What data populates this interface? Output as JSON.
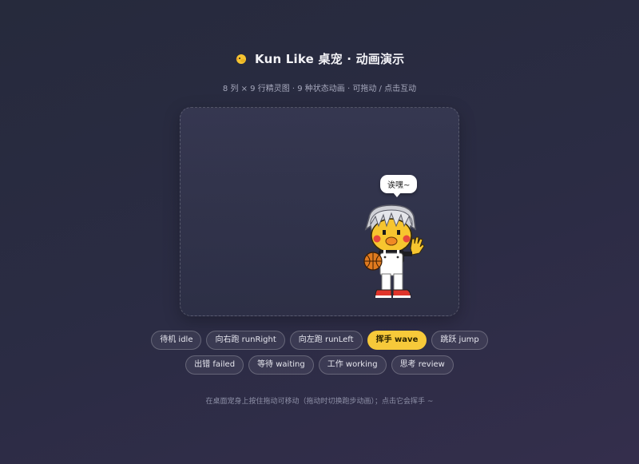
{
  "header": {
    "icon": "chick-icon",
    "title": "Kun Like 桌宠 · 动画演示",
    "subtitle": "8 列 × 9 行精灵图 · 9 种状态动画 · 可拖动 / 点击互动"
  },
  "stage": {
    "bubble_text": "诶嘿~",
    "pet_state": "wave"
  },
  "buttons": [
    {
      "label": "待机 idle",
      "active": false
    },
    {
      "label": "向右跑 runRight",
      "active": false
    },
    {
      "label": "向左跑 runLeft",
      "active": false
    },
    {
      "label": "挥手 wave",
      "active": true
    },
    {
      "label": "跳跃 jump",
      "active": false
    },
    {
      "label": "出错 failed",
      "active": false
    },
    {
      "label": "等待 waiting",
      "active": false
    },
    {
      "label": "工作 working",
      "active": false
    },
    {
      "label": "思考 review",
      "active": false
    }
  ],
  "hint": "在桌面宠身上按住拖动可移动（拖动时切换跑步动画）；点击它会挥手 ~",
  "colors": {
    "accent": "#f7c93a",
    "background": "#2b2c44"
  }
}
